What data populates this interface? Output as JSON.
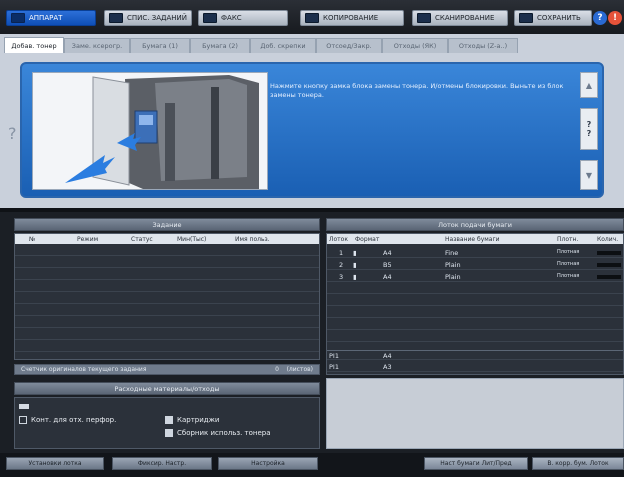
{
  "topbar": {
    "modes": [
      {
        "label": "АППАРАТ",
        "icon": "machine-icon",
        "active": true
      },
      {
        "label": "СПИС. ЗАДАНИЙ",
        "icon": "job-list-icon",
        "active": false
      },
      {
        "label": "ФАКС",
        "icon": "fax-icon",
        "active": false
      },
      {
        "label": "КОПИРОВАНИЕ",
        "icon": "copy-icon",
        "active": false
      },
      {
        "label": "СКАНИРОВАНИЕ",
        "icon": "scan-icon",
        "active": false
      },
      {
        "label": "СОХРАНИТЬ",
        "icon": "store-icon",
        "active": false
      }
    ]
  },
  "tabs": [
    {
      "label": "Добав. тонер",
      "active": true
    },
    {
      "label": "Заме. ксерогр.",
      "active": false
    },
    {
      "label": "Бумага (1)",
      "active": false
    },
    {
      "label": "Бумага (2)",
      "active": false
    },
    {
      "label": "Доб. скрепки",
      "active": false
    },
    {
      "label": "Отсоед/Закр.",
      "active": false
    },
    {
      "label": "Отходы (ЯК)",
      "active": false
    },
    {
      "label": "Отходы (Z-a..)",
      "active": false
    }
  ],
  "message": {
    "text": "Нажмите кнопку замка блока замены тонера. И/отмены блокировки. Выньте из блок замены тонера."
  },
  "jobs_panel": {
    "title": "Задание",
    "columns": [
      "№",
      "Режим",
      "Статус",
      "Мин(Тыс)",
      "Имя польз."
    ],
    "counter_label": "Счетчик оригиналов текущего задания",
    "counter_value": "0",
    "counter_unit": "(листов)"
  },
  "consumables_panel": {
    "title": "Расходные материалы/отходы",
    "items": [
      {
        "label": "Конт. для отх. перфор."
      },
      {
        "label": "Картриджи"
      },
      {
        "label": "Сборник использ. тонера"
      }
    ]
  },
  "tray_panel": {
    "title": "Лоток подачи бумаги",
    "columns": [
      "Лоток",
      "Формат",
      "Название бумаги",
      "Плотн.",
      "Колич."
    ],
    "rows": [
      {
        "tray": "1",
        "size": "A4",
        "name": "Fine",
        "weight": "Плотная"
      },
      {
        "tray": "2",
        "size": "B5",
        "name": "Plain",
        "weight": "Плотная"
      },
      {
        "tray": "3",
        "size": "A4",
        "name": "Plain",
        "weight": "Плотная"
      }
    ],
    "extra_rows": [
      {
        "tray": "PI1",
        "size": "A4"
      },
      {
        "tray": "PI1",
        "size": "A3"
      }
    ]
  },
  "bottombar": {
    "left_buttons": [
      "Установки лотка",
      "Фиксир. Настр.",
      "Настройка"
    ],
    "right_buttons": [
      "Наст бумаги Лит/Пред",
      "В. корр. бум. Лоток"
    ]
  },
  "colors": {
    "accent": "#1a5fb3",
    "active_mode": "#0f4fb6"
  }
}
